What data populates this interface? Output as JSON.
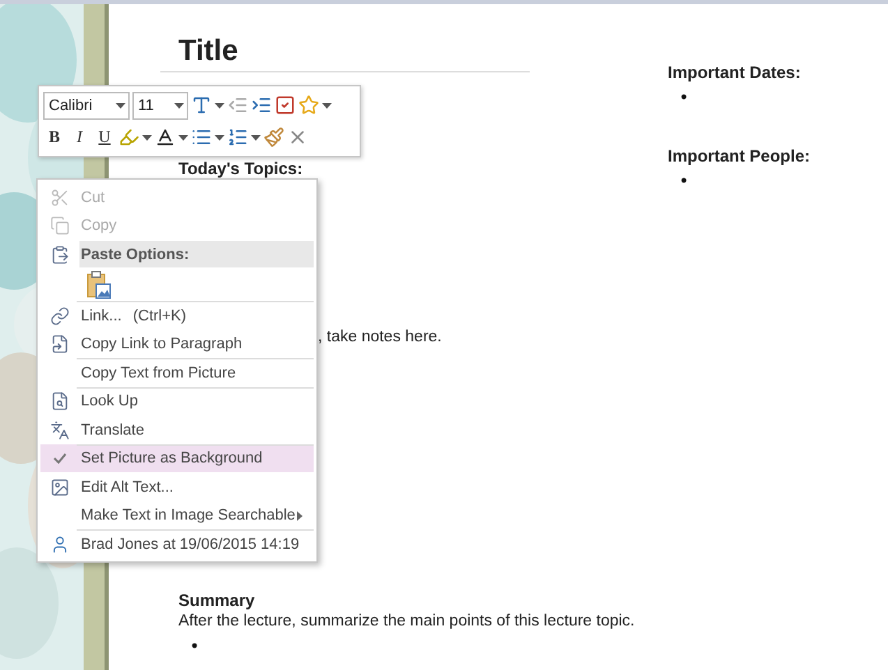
{
  "note": {
    "title": "Title",
    "topics_heading": "Today's Topics:",
    "notes_fragment": ", take notes here.",
    "summary_heading": "Summary",
    "summary_text": "After the lecture, summarize the main points of this lecture topic.",
    "summary_bullet": "•"
  },
  "side": [
    {
      "heading": "Important Dates:",
      "bullet": "•"
    },
    {
      "heading": "Important People:",
      "bullet": "•"
    }
  ],
  "mini_toolbar": {
    "font": "Calibri",
    "size": "11",
    "format_buttons": [
      "B",
      "I",
      "U"
    ]
  },
  "context_menu": {
    "items": [
      {
        "kind": "item",
        "label": "Cut",
        "disabled": true,
        "checked": false,
        "highlighted": false,
        "divider_before": false,
        "submenu": false
      },
      {
        "kind": "item",
        "label": "Copy",
        "disabled": true,
        "checked": false,
        "highlighted": false,
        "divider_before": false,
        "submenu": false
      },
      {
        "kind": "header",
        "label": "Paste Options:",
        "disabled": false,
        "checked": false,
        "highlighted": false,
        "divider_before": false,
        "submenu": false
      },
      {
        "kind": "paste",
        "disabled": false,
        "checked": false,
        "highlighted": false,
        "divider_before": false,
        "submenu": false
      },
      {
        "kind": "item",
        "label": "Link...",
        "shortcut": "(Ctrl+K)",
        "disabled": false,
        "checked": false,
        "highlighted": false,
        "divider_before": true,
        "submenu": false
      },
      {
        "kind": "item",
        "label": "Copy Link to Paragraph",
        "disabled": false,
        "checked": false,
        "highlighted": false,
        "divider_before": false,
        "submenu": false
      },
      {
        "kind": "item",
        "label": "Copy Text from Picture",
        "disabled": false,
        "checked": false,
        "highlighted": false,
        "divider_before": true,
        "submenu": false
      },
      {
        "kind": "item",
        "label": "Look Up",
        "disabled": false,
        "checked": false,
        "highlighted": false,
        "divider_before": true,
        "submenu": false
      },
      {
        "kind": "item",
        "label": "Translate",
        "disabled": false,
        "checked": false,
        "highlighted": false,
        "divider_before": false,
        "submenu": false
      },
      {
        "kind": "item",
        "label": "Set Picture as Background",
        "disabled": false,
        "checked": true,
        "highlighted": true,
        "divider_before": true,
        "submenu": false
      },
      {
        "kind": "item",
        "label": "Edit Alt Text...",
        "disabled": false,
        "checked": false,
        "highlighted": false,
        "divider_before": false,
        "submenu": false
      },
      {
        "kind": "item",
        "label": "Make Text in Image Searchable",
        "disabled": false,
        "checked": false,
        "highlighted": false,
        "divider_before": false,
        "submenu": true
      },
      {
        "kind": "item",
        "label": "Brad Jones at 19/06/2015 14:19",
        "disabled": false,
        "checked": false,
        "highlighted": false,
        "divider_before": true,
        "submenu": false
      }
    ]
  }
}
